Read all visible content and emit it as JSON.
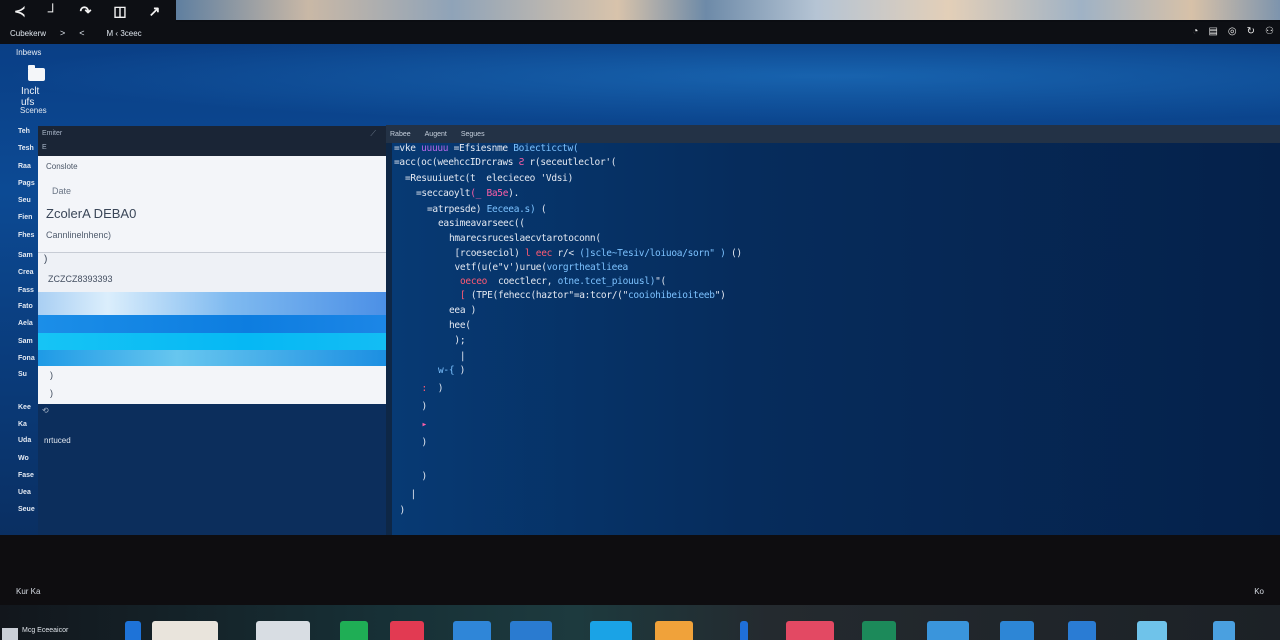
{
  "toolbar": {
    "icons": [
      {
        "name": "share-icon",
        "glyph": "≺"
      },
      {
        "name": "corner-icon",
        "glyph": "┘"
      },
      {
        "name": "redo-icon",
        "glyph": "↷"
      },
      {
        "name": "window-icon",
        "glyph": "◫"
      },
      {
        "name": "expand-icon",
        "glyph": "↗"
      }
    ]
  },
  "navbar": {
    "location": "Cubekerw",
    "forward": ">",
    "back": "<",
    "crumb": "M ‹ 3ceec"
  },
  "tray": {
    "icons": [
      {
        "name": "clock-icon",
        "glyph": "◔"
      },
      {
        "name": "stack-icon",
        "glyph": "▤"
      },
      {
        "name": "sync-icon",
        "glyph": "◎"
      },
      {
        "name": "refresh-icon",
        "glyph": "↻"
      },
      {
        "name": "user-icon",
        "glyph": "⚇"
      }
    ]
  },
  "sidebar": {
    "title": "Inbews",
    "folder_label": "Inclt ufs",
    "subtitle": "Scenes",
    "items": [
      "Teh",
      "Tesh",
      "Raa",
      "Pags",
      "Seu",
      "Fien",
      "Fhes",
      "Sam",
      "Crea",
      "Fass",
      "Fato",
      "Aela",
      "Sam",
      "Fona",
      "Su",
      "Kee",
      "Ka",
      "Uda",
      "Wo",
      "Fase",
      "Uea",
      "Seue"
    ]
  },
  "left_window": {
    "title": "Emiter",
    "subtitle": "E",
    "panel": {
      "header": "Conslote",
      "date": "Date",
      "big_title": "ZcolerA DEBA0",
      "subtitle": "Cannlinelnhenc)",
      "paren1": ")",
      "code_line": "ZCZCZ8393393",
      "paren2": ")",
      "paren3": ")"
    },
    "footer_icon": "⟲",
    "footer_text": "nrtuced"
  },
  "editor": {
    "tabs": [
      "Rabee",
      "Augent",
      "Segues"
    ],
    "lines": [
      {
        "indent": 0,
        "parts": [
          {
            "t": "=vke ",
            "c": "white"
          },
          {
            "t": "uuuuu ",
            "c": "purple"
          },
          {
            "t": "=Efsiesnme ",
            "c": "white"
          },
          {
            "t": "Boiecticctw(",
            "c": "blue"
          }
        ]
      },
      {
        "indent": 0,
        "parts": [
          {
            "t": "=acc(oc(weehccIDrcraws ",
            "c": "white"
          },
          {
            "t": "Ƨ",
            "c": "pink"
          },
          {
            "t": " r(seceutleclor'(",
            "c": "white"
          }
        ]
      },
      {
        "indent": 2,
        "parts": [
          {
            "t": "=Resuuiuetc(t ",
            "c": "white"
          },
          {
            "t": " elecieceo 'Vdsi)",
            "c": "white"
          }
        ]
      },
      {
        "indent": 4,
        "parts": [
          {
            "t": "=seccaoylt",
            "c": "white"
          },
          {
            "t": "(_ ",
            "c": "pink"
          },
          {
            "t": "Ba5e",
            "c": "pink"
          },
          {
            "t": ").",
            "c": "white"
          }
        ]
      },
      {
        "indent": 6,
        "parts": [
          {
            "t": "=atrpesde) ",
            "c": "white"
          },
          {
            "t": "Eeceea.s) ",
            "c": "blue"
          },
          {
            "t": "(",
            "c": "white"
          }
        ]
      },
      {
        "indent": 8,
        "parts": [
          {
            "t": "easimeavarseec((",
            "c": "white"
          }
        ]
      },
      {
        "indent": 10,
        "parts": [
          {
            "t": "hmarecsruceslaecvtarotoconn(",
            "c": "white"
          }
        ]
      },
      {
        "indent": 11,
        "parts": [
          {
            "t": "[rcoeseciol) ",
            "c": "white"
          },
          {
            "t": "l eec ",
            "c": "red"
          },
          {
            "t": "r/< ",
            "c": "white"
          },
          {
            "t": "(]scle~Tesiv/loiuoa/sorn\" ) ",
            "c": "blue"
          },
          {
            "t": "()",
            "c": "white"
          }
        ]
      },
      {
        "indent": 11,
        "parts": [
          {
            "t": "vetf(u(e\"v')urue(",
            "c": "white"
          },
          {
            "t": "vorgrtheatlieea",
            "c": "blue"
          }
        ]
      },
      {
        "indent": 12,
        "parts": [
          {
            "t": "oeceo  ",
            "c": "red"
          },
          {
            "t": "coectlecr, ",
            "c": "white"
          },
          {
            "t": "otne.tcet_piouusl)",
            "c": "blue"
          },
          {
            "t": "\"(",
            "c": "white"
          }
        ]
      },
      {
        "indent": 12,
        "parts": [
          {
            "t": "[ ",
            "c": "red"
          },
          {
            "t": "(TPE(fehecc(haztor\"=a:tcor/(\"",
            "c": "white"
          },
          {
            "t": "cooiohibeioiteeb",
            "c": "blue"
          },
          {
            "t": "\")",
            "c": "white"
          }
        ]
      },
      {
        "indent": 10,
        "parts": [
          {
            "t": "eea )",
            "c": "white"
          }
        ]
      },
      {
        "indent": 10,
        "parts": [
          {
            "t": "hee(",
            "c": "white"
          }
        ]
      },
      {
        "indent": 10,
        "parts": [
          {
            "t": " );",
            "c": "white"
          }
        ]
      },
      {
        "indent": 10,
        "parts": [
          {
            "t": "  |",
            "c": "white"
          }
        ]
      },
      {
        "indent": 8,
        "parts": [
          {
            "t": "w-{",
            "c": "blue"
          },
          {
            "t": " )",
            "c": "white"
          }
        ]
      },
      {
        "indent": 5,
        "parts": [
          {
            "t": ": ",
            "c": "red"
          },
          {
            "t": " )",
            "c": "white"
          }
        ]
      },
      {
        "indent": 5,
        "parts": [
          {
            "t": ")",
            "c": "white"
          }
        ]
      },
      {
        "indent": 5,
        "parts": [
          {
            "t": "▸",
            "c": "pink"
          }
        ]
      },
      {
        "indent": 5,
        "parts": [
          {
            "t": ")",
            "c": "white"
          }
        ]
      },
      {
        "indent": 5,
        "parts": [
          {
            "t": "",
            "c": "white"
          }
        ]
      },
      {
        "indent": 5,
        "parts": [
          {
            "t": ")",
            "c": "white"
          }
        ]
      },
      {
        "indent": 3,
        "parts": [
          {
            "t": "|",
            "c": "white"
          }
        ]
      },
      {
        "indent": 1,
        "parts": [
          {
            "t": ")",
            "c": "white"
          }
        ]
      }
    ]
  },
  "bottombar": {
    "left_text": "Kur Ka",
    "right_text": "Ko"
  },
  "taskbar": {
    "start_label": "Mcg Eceeaicor",
    "apps": [
      {
        "name": "app-blue-figure",
        "color": "#1e73d8"
      },
      {
        "name": "app-white-window",
        "color": "#e9e4dc"
      },
      {
        "name": "app-outline-shapes",
        "color": "#d8dde3"
      },
      {
        "name": "app-green",
        "color": "#1fae55"
      },
      {
        "name": "app-red",
        "color": "#e23a52"
      },
      {
        "name": "app-blue-folder",
        "color": "#2f86d8"
      },
      {
        "name": "app-blue-window",
        "color": "#2a7bd0"
      },
      {
        "name": "app-light-blue",
        "color": "#1aa3e6"
      },
      {
        "name": "app-orange",
        "color": "#f0a23a"
      },
      {
        "name": "app-pen",
        "color": "#1f6fd8"
      },
      {
        "name": "app-pink-text",
        "color": "#e34963"
      },
      {
        "name": "app-green-arrow",
        "color": "#1c8a5a"
      },
      {
        "name": "app-blue-box",
        "color": "#3a95dc"
      },
      {
        "name": "app-blue-square",
        "color": "#2d86d6"
      },
      {
        "name": "app-blue-doc",
        "color": "#2a7cd4"
      },
      {
        "name": "app-grid",
        "color": "#6fc3ea"
      },
      {
        "name": "app-arrow-tile",
        "color": "#4aa0e0"
      }
    ]
  }
}
